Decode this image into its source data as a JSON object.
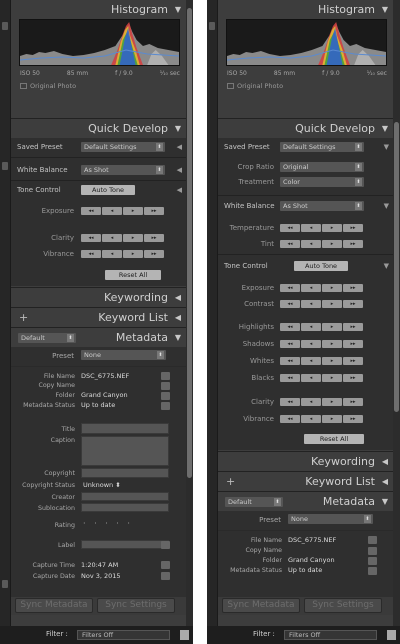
{
  "histogram": {
    "title": "Histogram",
    "iso": "ISO 50",
    "focal": "85 mm",
    "aperture": "f / 9.0",
    "shutter": "¹⁄₁₀ sec",
    "original_photo": "Original Photo"
  },
  "quick_develop": {
    "title": "Quick Develop",
    "saved_preset_label": "Saved Preset",
    "saved_preset_value": "Default Settings",
    "crop_ratio_label": "Crop Ratio",
    "crop_ratio_value": "Original",
    "treatment_label": "Treatment",
    "treatment_value": "Color",
    "white_balance_label": "White Balance",
    "white_balance_value": "As Shot",
    "temperature_label": "Temperature",
    "tint_label": "Tint",
    "tone_control_label": "Tone Control",
    "auto_tone": "Auto Tone",
    "exposure_label": "Exposure",
    "contrast_label": "Contrast",
    "highlights_label": "Highlights",
    "shadows_label": "Shadows",
    "whites_label": "Whites",
    "blacks_label": "Blacks",
    "clarity_label": "Clarity",
    "vibrance_label": "Vibrance",
    "reset_all": "Reset All"
  },
  "keywording": {
    "title": "Keywording"
  },
  "keyword_list": {
    "title": "Keyword List",
    "plus": "+"
  },
  "metadata": {
    "title": "Metadata",
    "preset_dropdown": "Default",
    "preset_label": "Preset",
    "preset_value": "None",
    "file_name_label": "File Name",
    "file_name_value": "DSC_6775.NEF",
    "copy_name_label": "Copy Name",
    "folder_label": "Folder",
    "folder_value": "Grand Canyon",
    "metadata_status_label": "Metadata Status",
    "metadata_status_value": "Up to date",
    "title_label": "Title",
    "caption_label": "Caption",
    "copyright_label": "Copyright",
    "copyright_status_label": "Copyright Status",
    "copyright_status_value": "Unknown",
    "creator_label": "Creator",
    "sublocation_label": "Sublocation",
    "rating_label": "Rating",
    "rating_value": "· · · · ·",
    "label_label": "Label",
    "capture_time_label": "Capture Time",
    "capture_time_value": "1:20:47 AM",
    "capture_date_label": "Capture Date",
    "capture_date_value": "Nov 3, 2015"
  },
  "sync": {
    "sync_metadata": "Sync Metadata",
    "sync_settings": "Sync Settings"
  },
  "filter": {
    "label": "Filter :",
    "value": "Filters Off"
  },
  "icons": {
    "collapse": "▼",
    "expand": "◀",
    "stepper": [
      "◂◂",
      "◂",
      "▸",
      "▸▸"
    ]
  }
}
